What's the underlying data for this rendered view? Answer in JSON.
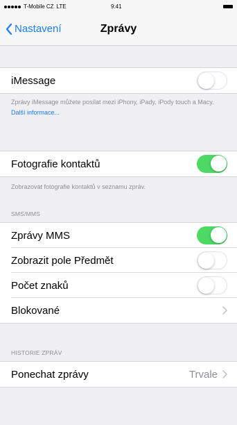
{
  "status_bar": {
    "carrier": "T-Mobile CZ",
    "network": "LTE",
    "time": "9:41"
  },
  "nav": {
    "back_label": "Nastavení",
    "title": "Zprávy"
  },
  "imessage": {
    "label": "iMessage",
    "enabled": false,
    "footer_text": "Zprávy iMessage můžete posílat mezi iPhony, iPady, iPody touch a Macy.",
    "footer_link": "Další informace..."
  },
  "contact_photos": {
    "label": "Fotografie kontaktů",
    "enabled": true,
    "footer_text": "Zobrazovat fotografie kontaktů v seznamu zpráv."
  },
  "sms_mms": {
    "header": "SMS/MMS",
    "items": [
      {
        "label": "Zprávy MMS",
        "type": "toggle",
        "enabled": true
      },
      {
        "label": "Zobrazit pole Předmět",
        "type": "toggle",
        "enabled": false
      },
      {
        "label": "Počet znaků",
        "type": "toggle",
        "enabled": false
      },
      {
        "label": "Blokované",
        "type": "disclosure"
      }
    ]
  },
  "history": {
    "header": "HISTORIE ZPRÁV",
    "keep_label": "Ponechat zprávy",
    "keep_value": "Trvale"
  },
  "colors": {
    "accent": "#1a7cf6",
    "toggle_on": "#4cd964",
    "background": "#efeff4"
  }
}
